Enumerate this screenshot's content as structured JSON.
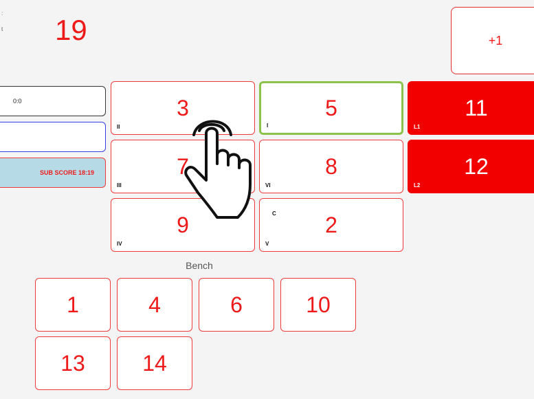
{
  "header": {
    "score": "19",
    "edge_marks": [
      ":",
      "t"
    ],
    "plus_label": "+1"
  },
  "left_panel": {
    "timeout_value": "0:0",
    "name_value": "",
    "sub_score_label": "SUB SCORE 18:19"
  },
  "court": [
    {
      "number": "3",
      "position": "II"
    },
    {
      "number": "5",
      "position": "I",
      "serving": true
    },
    {
      "number": "7",
      "position": "III"
    },
    {
      "number": "8",
      "position": "VI"
    },
    {
      "number": "9",
      "position": "IV"
    },
    {
      "number": "2",
      "position": "V",
      "captain": "C"
    }
  ],
  "liberos": [
    {
      "number": "11",
      "label": "L1"
    },
    {
      "number": "12",
      "label": "L2"
    }
  ],
  "bench": {
    "label": "Bench",
    "players": [
      "1",
      "4",
      "6",
      "10",
      "13",
      "14"
    ]
  },
  "colors": {
    "accent": "#ee1a1a",
    "libero_fill": "#f20000",
    "server_border": "#8bc34a",
    "sub_score_bg": "#b7dbe6",
    "name_field_border": "#3240e6"
  },
  "cursor_icon": "hand-pointer-icon"
}
